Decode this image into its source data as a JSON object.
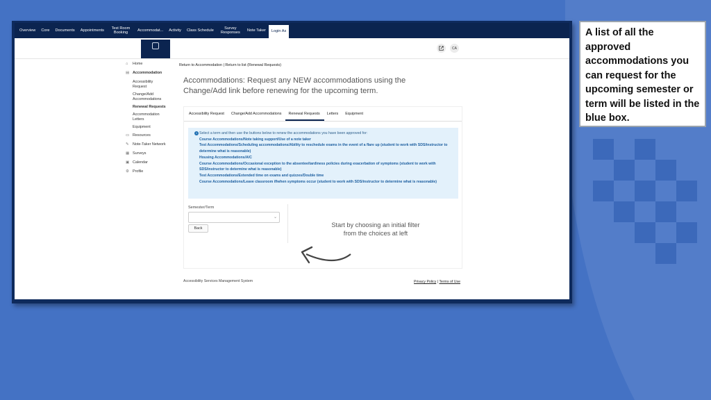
{
  "colors": {
    "slide_background": "#4472c4",
    "nav_background": "#0b2450",
    "info_background": "#e3f1fb",
    "info_text": "#1d5fa0"
  },
  "callout": {
    "text": "A list of all the approved accommodations you can request for the upcoming semester or term will be listed in the blue box."
  },
  "topnav": {
    "items": [
      {
        "label": "Overview"
      },
      {
        "label": "Core"
      },
      {
        "label": "Documents"
      },
      {
        "label": "Appointments"
      },
      {
        "label": "Test Room Booking"
      },
      {
        "label": "Accommodat..."
      },
      {
        "label": "Activity"
      },
      {
        "label": "Class Schedule"
      },
      {
        "label": "Survey Responses"
      },
      {
        "label": "Note Taker"
      },
      {
        "label": "Login As"
      }
    ]
  },
  "header": {
    "user_initials": "CA",
    "external_icon": "external-link-icon"
  },
  "sidebar": {
    "home": "Home",
    "accommodation": "Accommodation",
    "sub": [
      "Accessibility Request",
      "Change/Add Accommodations",
      "Renewal Requests",
      "Accommodation Letters",
      "Equipment"
    ],
    "resources": "Resources",
    "note_taker": "Note-Taker Network",
    "surveys": "Surveys",
    "calendar": "Calendar",
    "profile": "Profile"
  },
  "breadcrumb": "Return to Accommodation | Return to list (Renewal Requests)",
  "page_title": "Accommodations: Request any NEW accommodations using the Change/Add link before renewing for the upcoming term.",
  "tabs": [
    "Accessibility Request",
    "Change/Add Accommodations",
    "Renewal Requests",
    "Letters",
    "Equipment"
  ],
  "info": {
    "lead": "Select a term and then use the buttons below to renew the accommodations you have been approved for:",
    "items": [
      "Course Accommodations/Note taking support/Use of a note taker",
      "Test Accommodations/Scheduling accommodations/Ability to reschedule exams in the event of a flare up (student to work with SDS/instructor to determine what is reasonable)",
      "Housing Accommodations/A/C",
      "Course Accommodations/Occasional exception to the absentee/tardiness policies during exacerbation of symptoms (student to work with SDS/instructor to determine what is reasonable)",
      "Test Accommodations/Extended time on exams and quizzes/Double time",
      "Course Accommodations/Leave classroom if/when symptoms occur (student to work with SDS/instructor to determine what is reasonable)"
    ]
  },
  "filter": {
    "label": "Semester/Term",
    "selected": "",
    "back": "Back"
  },
  "empty_message": "Start by choosing an initial filter from the choices at left",
  "footer": {
    "system": "Accessibility Services Management System",
    "privacy": "Privacy Policy",
    "sep": " | ",
    "terms": "Terms of Use"
  }
}
